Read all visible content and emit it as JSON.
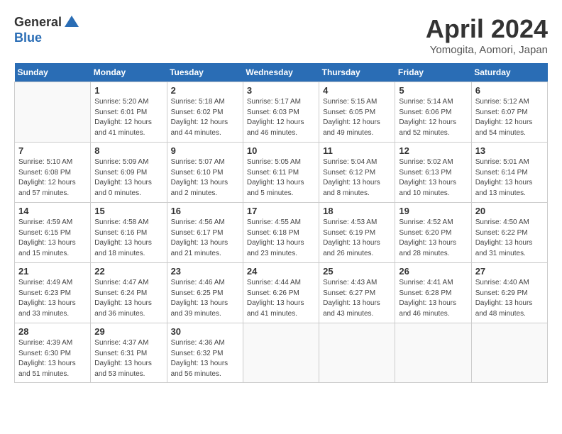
{
  "logo": {
    "general": "General",
    "blue": "Blue"
  },
  "title": "April 2024",
  "subtitle": "Yomogita, Aomori, Japan",
  "headers": [
    "Sunday",
    "Monday",
    "Tuesday",
    "Wednesday",
    "Thursday",
    "Friday",
    "Saturday"
  ],
  "weeks": [
    [
      {
        "num": "",
        "info": ""
      },
      {
        "num": "1",
        "info": "Sunrise: 5:20 AM\nSunset: 6:01 PM\nDaylight: 12 hours\nand 41 minutes."
      },
      {
        "num": "2",
        "info": "Sunrise: 5:18 AM\nSunset: 6:02 PM\nDaylight: 12 hours\nand 44 minutes."
      },
      {
        "num": "3",
        "info": "Sunrise: 5:17 AM\nSunset: 6:03 PM\nDaylight: 12 hours\nand 46 minutes."
      },
      {
        "num": "4",
        "info": "Sunrise: 5:15 AM\nSunset: 6:05 PM\nDaylight: 12 hours\nand 49 minutes."
      },
      {
        "num": "5",
        "info": "Sunrise: 5:14 AM\nSunset: 6:06 PM\nDaylight: 12 hours\nand 52 minutes."
      },
      {
        "num": "6",
        "info": "Sunrise: 5:12 AM\nSunset: 6:07 PM\nDaylight: 12 hours\nand 54 minutes."
      }
    ],
    [
      {
        "num": "7",
        "info": "Sunrise: 5:10 AM\nSunset: 6:08 PM\nDaylight: 12 hours\nand 57 minutes."
      },
      {
        "num": "8",
        "info": "Sunrise: 5:09 AM\nSunset: 6:09 PM\nDaylight: 13 hours\nand 0 minutes."
      },
      {
        "num": "9",
        "info": "Sunrise: 5:07 AM\nSunset: 6:10 PM\nDaylight: 13 hours\nand 2 minutes."
      },
      {
        "num": "10",
        "info": "Sunrise: 5:05 AM\nSunset: 6:11 PM\nDaylight: 13 hours\nand 5 minutes."
      },
      {
        "num": "11",
        "info": "Sunrise: 5:04 AM\nSunset: 6:12 PM\nDaylight: 13 hours\nand 8 minutes."
      },
      {
        "num": "12",
        "info": "Sunrise: 5:02 AM\nSunset: 6:13 PM\nDaylight: 13 hours\nand 10 minutes."
      },
      {
        "num": "13",
        "info": "Sunrise: 5:01 AM\nSunset: 6:14 PM\nDaylight: 13 hours\nand 13 minutes."
      }
    ],
    [
      {
        "num": "14",
        "info": "Sunrise: 4:59 AM\nSunset: 6:15 PM\nDaylight: 13 hours\nand 15 minutes."
      },
      {
        "num": "15",
        "info": "Sunrise: 4:58 AM\nSunset: 6:16 PM\nDaylight: 13 hours\nand 18 minutes."
      },
      {
        "num": "16",
        "info": "Sunrise: 4:56 AM\nSunset: 6:17 PM\nDaylight: 13 hours\nand 21 minutes."
      },
      {
        "num": "17",
        "info": "Sunrise: 4:55 AM\nSunset: 6:18 PM\nDaylight: 13 hours\nand 23 minutes."
      },
      {
        "num": "18",
        "info": "Sunrise: 4:53 AM\nSunset: 6:19 PM\nDaylight: 13 hours\nand 26 minutes."
      },
      {
        "num": "19",
        "info": "Sunrise: 4:52 AM\nSunset: 6:20 PM\nDaylight: 13 hours\nand 28 minutes."
      },
      {
        "num": "20",
        "info": "Sunrise: 4:50 AM\nSunset: 6:22 PM\nDaylight: 13 hours\nand 31 minutes."
      }
    ],
    [
      {
        "num": "21",
        "info": "Sunrise: 4:49 AM\nSunset: 6:23 PM\nDaylight: 13 hours\nand 33 minutes."
      },
      {
        "num": "22",
        "info": "Sunrise: 4:47 AM\nSunset: 6:24 PM\nDaylight: 13 hours\nand 36 minutes."
      },
      {
        "num": "23",
        "info": "Sunrise: 4:46 AM\nSunset: 6:25 PM\nDaylight: 13 hours\nand 39 minutes."
      },
      {
        "num": "24",
        "info": "Sunrise: 4:44 AM\nSunset: 6:26 PM\nDaylight: 13 hours\nand 41 minutes."
      },
      {
        "num": "25",
        "info": "Sunrise: 4:43 AM\nSunset: 6:27 PM\nDaylight: 13 hours\nand 43 minutes."
      },
      {
        "num": "26",
        "info": "Sunrise: 4:41 AM\nSunset: 6:28 PM\nDaylight: 13 hours\nand 46 minutes."
      },
      {
        "num": "27",
        "info": "Sunrise: 4:40 AM\nSunset: 6:29 PM\nDaylight: 13 hours\nand 48 minutes."
      }
    ],
    [
      {
        "num": "28",
        "info": "Sunrise: 4:39 AM\nSunset: 6:30 PM\nDaylight: 13 hours\nand 51 minutes."
      },
      {
        "num": "29",
        "info": "Sunrise: 4:37 AM\nSunset: 6:31 PM\nDaylight: 13 hours\nand 53 minutes."
      },
      {
        "num": "30",
        "info": "Sunrise: 4:36 AM\nSunset: 6:32 PM\nDaylight: 13 hours\nand 56 minutes."
      },
      {
        "num": "",
        "info": ""
      },
      {
        "num": "",
        "info": ""
      },
      {
        "num": "",
        "info": ""
      },
      {
        "num": "",
        "info": ""
      }
    ]
  ]
}
